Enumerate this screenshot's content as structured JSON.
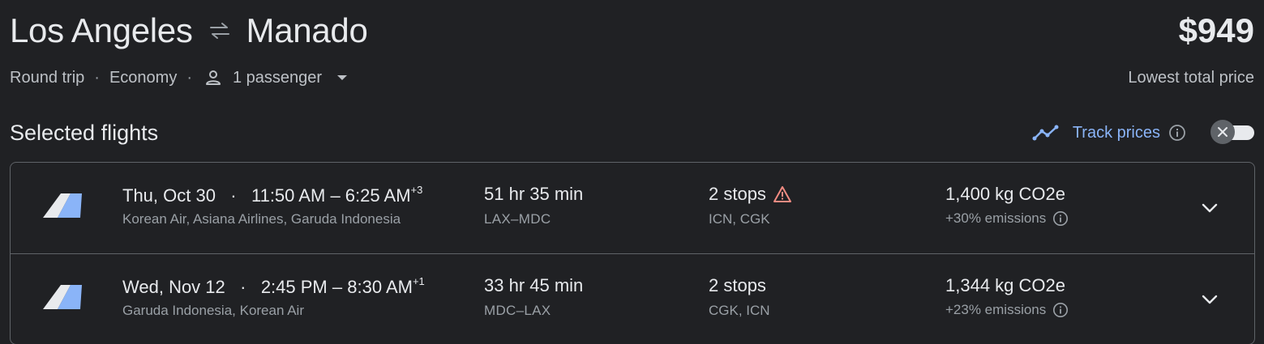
{
  "header": {
    "origin": "Los Angeles",
    "destination": "Manado",
    "price": "$949",
    "trip_type": "Round trip",
    "cabin_class": "Economy",
    "passengers": "1 passenger",
    "price_note": "Lowest total price"
  },
  "section": {
    "title": "Selected flights",
    "track_label": "Track prices",
    "track_enabled": false
  },
  "flights": [
    {
      "date": "Thu, Oct 30",
      "depart": "11:50 AM",
      "arrive": "6:25 AM",
      "day_offset": "+3",
      "airlines": "Korean Air, Asiana Airlines, Garuda Indonesia",
      "duration": "51 hr 35 min",
      "route": "LAX–MDC",
      "stops": "2 stops",
      "stop_codes": "ICN, CGK",
      "has_warning": true,
      "co2": "1,400 kg CO2e",
      "emissions": "+30% emissions"
    },
    {
      "date": "Wed, Nov 12",
      "depart": "2:45 PM",
      "arrive": "8:30 AM",
      "day_offset": "+1",
      "airlines": "Garuda Indonesia, Korean Air",
      "duration": "33 hr 45 min",
      "route": "MDC–LAX",
      "stops": "2 stops",
      "stop_codes": "CGK, ICN",
      "has_warning": false,
      "co2": "1,344 kg CO2e",
      "emissions": "+23% emissions"
    }
  ],
  "icons": {
    "swap": "swap-arrows-icon",
    "person": "person-icon",
    "caret": "caret-down-icon",
    "trend": "trend-line-icon",
    "info": "info-icon",
    "warning": "warning-triangle-icon",
    "chevron": "chevron-down-icon",
    "airline_logo": "multi-airline-logo"
  },
  "colors": {
    "background": "#202124",
    "accent": "#8ab4f8",
    "warning": "#f28b82",
    "logo_tail_light": "#e8eaed",
    "logo_tail_blue": "#8ab4f8"
  }
}
